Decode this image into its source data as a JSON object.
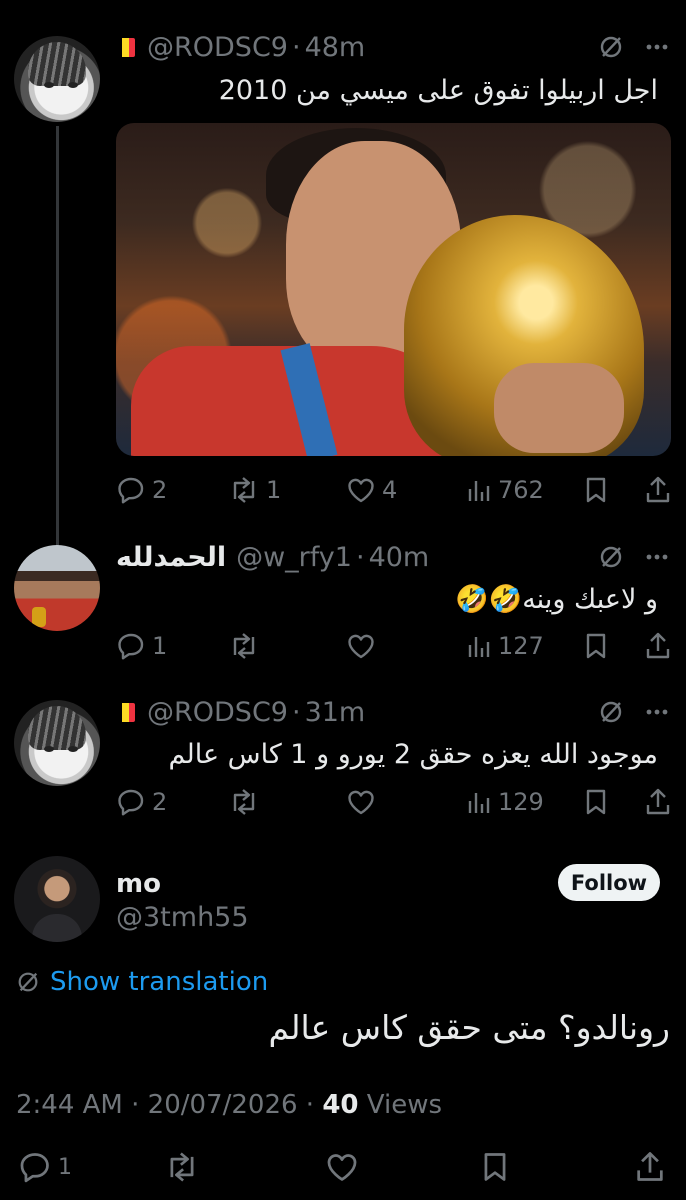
{
  "replies": [
    {
      "handle": "@RODSC9",
      "time": "48m",
      "flag_colors": [
        "#000000",
        "#FDDA24",
        "#EF3340"
      ],
      "text": "اجل اربيلوا تفوق على ميسي من 2010",
      "has_media": true,
      "media_icon": "photo-world-cup-trophy",
      "stats": {
        "replies": "2",
        "reposts": "1",
        "likes": "4",
        "views": "762"
      }
    },
    {
      "display_name": "الحمدلله",
      "handle": "@w_rfy1",
      "time": "40m",
      "text": "و لاعبك وينه🤣🤣",
      "stats": {
        "replies": "1",
        "reposts": "",
        "likes": "",
        "views": "127"
      }
    },
    {
      "handle": "@RODSC9",
      "time": "31m",
      "flag_colors": [
        "#000000",
        "#FDDA24",
        "#EF3340"
      ],
      "text": "موجود الله يعزه حقق 2 يورو و 1 كاس عالم",
      "stats": {
        "replies": "2",
        "reposts": "",
        "likes": "",
        "views": "129"
      }
    }
  ],
  "main_tweet": {
    "display_name": "mo",
    "handle": "@3tmh55",
    "follow_label": "Follow",
    "show_translation_label": "Show translation",
    "text": "رونالدو؟ متى حقق كاس عالم",
    "time": "2:44 AM",
    "date": "20/07/2026",
    "views_count": "40",
    "views_label": "Views",
    "stats": {
      "replies": "1"
    }
  },
  "colors": {
    "background": "#000000",
    "primary_text": "#e7e9ea",
    "secondary_text": "#71767b",
    "link": "#1d9bf0",
    "divider": "#333639"
  }
}
